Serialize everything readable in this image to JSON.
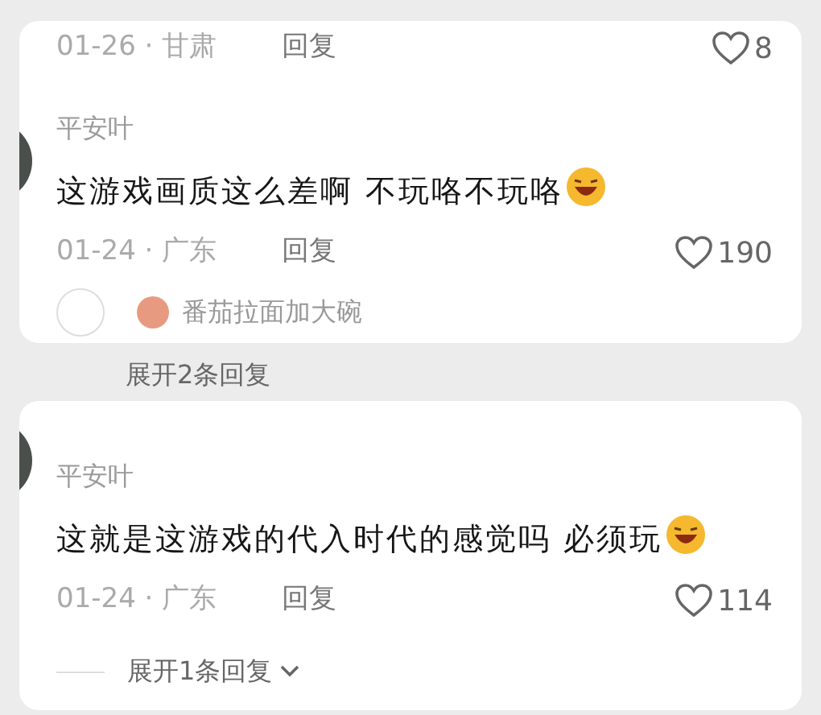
{
  "cards": [
    {
      "items": [
        {
          "kind": "meta",
          "time_place": "01-26 · 甘肃",
          "reply": "回复",
          "likes": "8"
        },
        {
          "kind": "comment",
          "author": "平安叶",
          "text": "这游戏画质这么差啊 不玩咯不玩咯",
          "time_place": "01-24 · 广东",
          "reply": "回复",
          "likes": "190"
        },
        {
          "kind": "sub_reply",
          "author": "番茄拉面加大碗"
        }
      ]
    },
    {
      "items": [
        {
          "kind": "hidden_expand",
          "label": "展开2条回复"
        }
      ]
    },
    {
      "items": [
        {
          "kind": "comment",
          "author": "平安叶",
          "text": "这就是这游戏的代入时代的感觉吗 必须玩",
          "time_place": "01-24 · 广东",
          "reply": "回复",
          "likes": "114"
        },
        {
          "kind": "expand",
          "label": "展开1条回复"
        }
      ]
    }
  ]
}
